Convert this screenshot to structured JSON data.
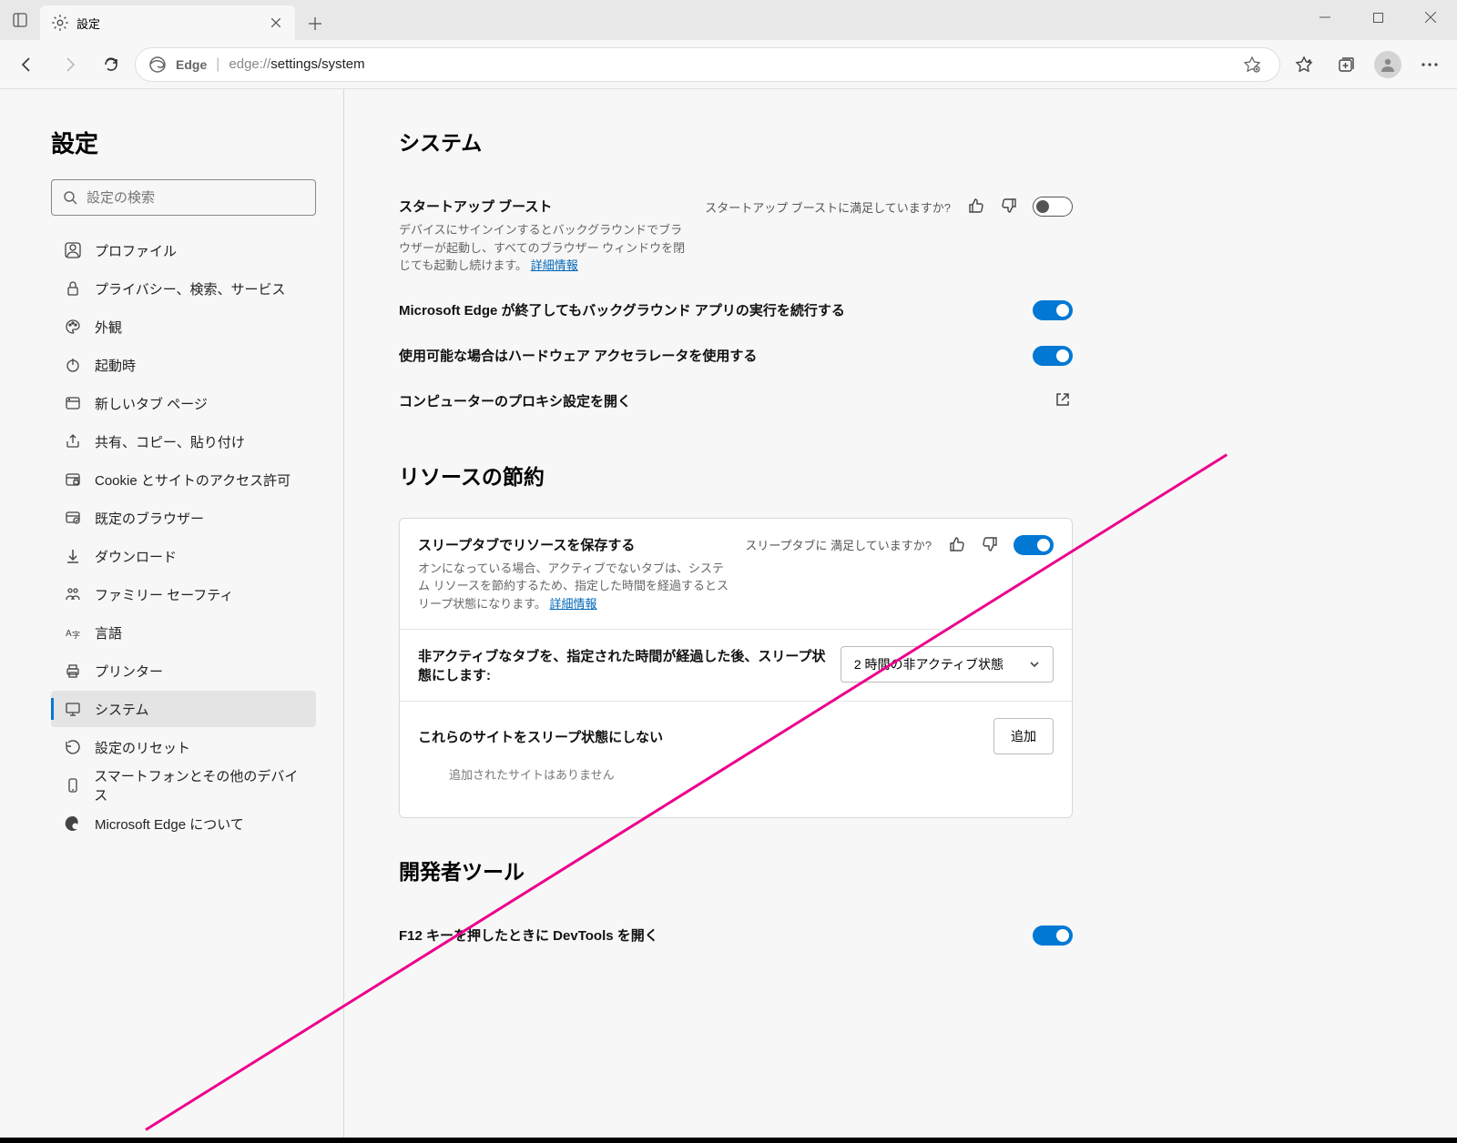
{
  "tab": {
    "title": "設定"
  },
  "toolbar": {
    "edge_label": "Edge",
    "url_prefix": "edge://",
    "url_path": "settings/system"
  },
  "sidebar": {
    "title": "設定",
    "search_placeholder": "設定の検索",
    "items": [
      {
        "label": "プロファイル"
      },
      {
        "label": "プライバシー、検索、サービス"
      },
      {
        "label": "外観"
      },
      {
        "label": "起動時"
      },
      {
        "label": "新しいタブ ページ"
      },
      {
        "label": "共有、コピー、貼り付け"
      },
      {
        "label": "Cookie とサイトのアクセス許可"
      },
      {
        "label": "既定のブラウザー"
      },
      {
        "label": "ダウンロード"
      },
      {
        "label": "ファミリー セーフティ"
      },
      {
        "label": "言語"
      },
      {
        "label": "プリンター"
      },
      {
        "label": "システム"
      },
      {
        "label": "設定のリセット"
      },
      {
        "label": "スマートフォンとその他のデバイス"
      },
      {
        "label": "Microsoft Edge について"
      }
    ]
  },
  "sections": {
    "system": {
      "heading": "システム",
      "startup_boost": {
        "title": "スタートアップ ブースト",
        "desc": "デバイスにサインインするとバックグラウンドでブラウザーが起動し、すべてのブラウザー ウィンドウを閉じても起動し続けます。",
        "link": "詳細情報",
        "feedback": "スタートアップ ブーストに満足していますか?"
      },
      "bg_apps": {
        "title": "Microsoft Edge が終了してもバックグラウンド アプリの実行を続行する"
      },
      "hw_accel": {
        "title": "使用可能な場合はハードウェア アクセラレータを使用する"
      },
      "proxy": {
        "title": "コンピューターのプロキシ設定を開く"
      }
    },
    "resources": {
      "heading": "リソースの節約",
      "sleep_tabs": {
        "title": "スリープタブでリソースを保存する",
        "desc": "オンになっている場合、アクティブでないタブは、システム リソースを節約するため、指定した時間を経過するとスリープ状態になります。",
        "link": "詳細情報",
        "feedback": "スリープタブに 満足していますか?"
      },
      "inactive": {
        "title": "非アクティブなタブを、指定された時間が経過した後、スリープ状態にします:",
        "value": "2 時間の非アクティブ状態"
      },
      "nosleep": {
        "title": "これらのサイトをスリープ状態にしない",
        "add": "追加",
        "empty": "追加されたサイトはありません"
      }
    },
    "devtools": {
      "heading": "開発者ツール",
      "f12": {
        "title": "F12 キーを押したときに DevTools を開く"
      }
    }
  }
}
